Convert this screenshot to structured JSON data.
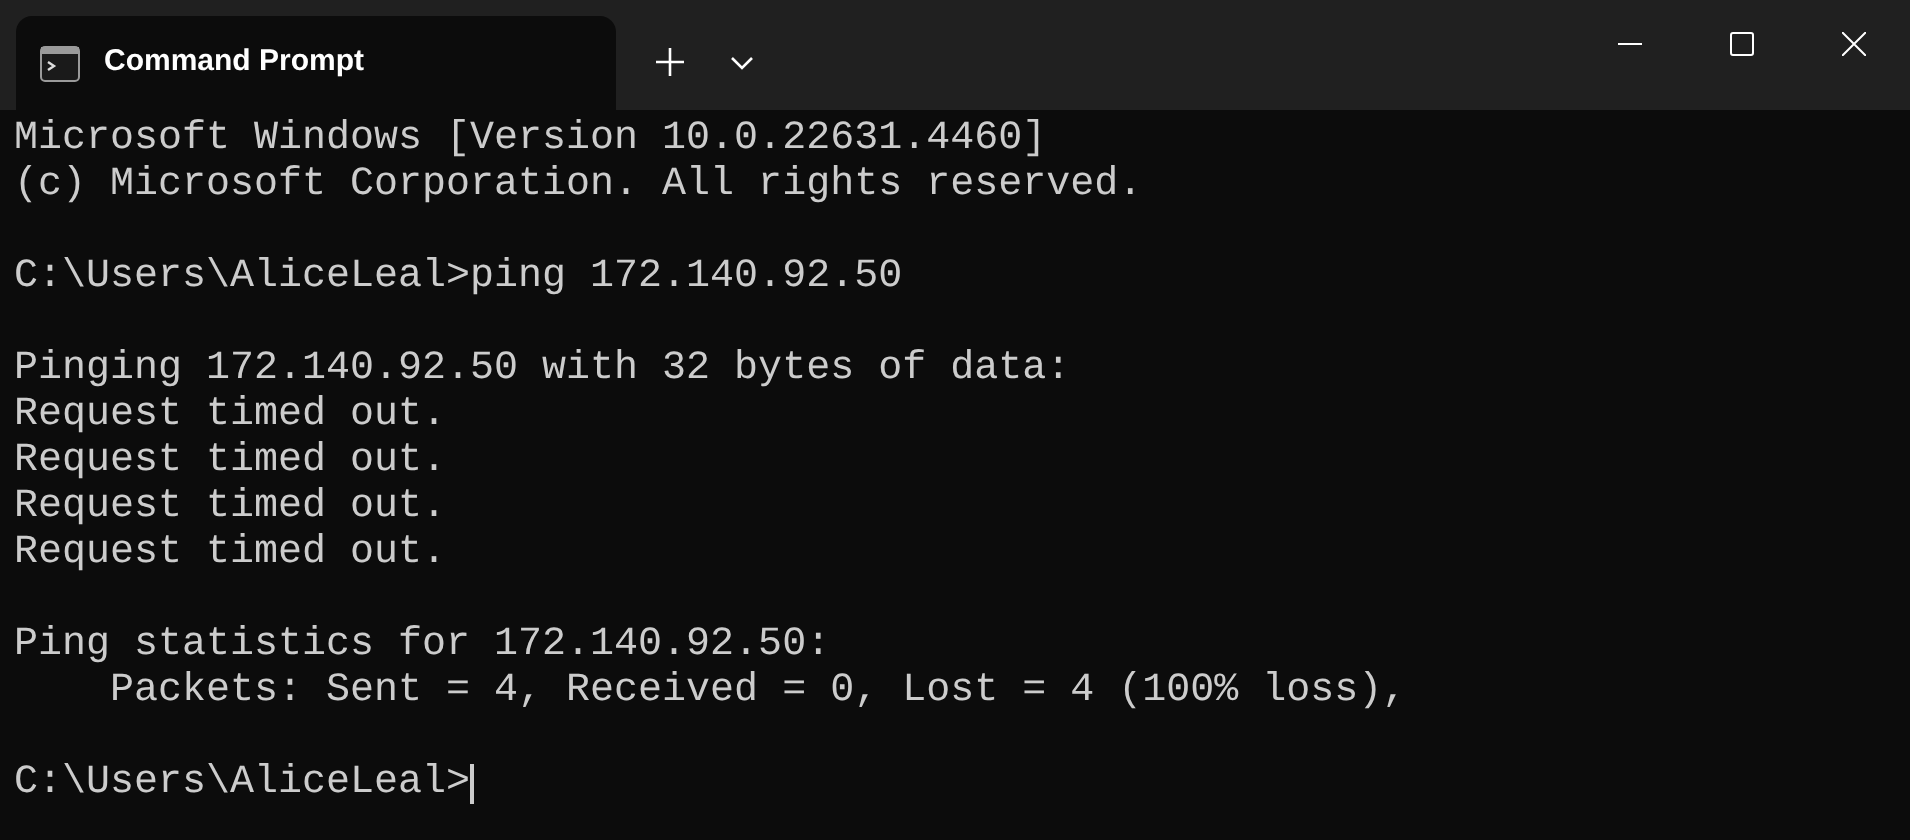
{
  "tabs": [
    {
      "title": "Command Prompt",
      "selected": true
    }
  ],
  "terminal": {
    "blocks": [
      [
        "Microsoft Windows [Version 10.0.22631.4460]",
        "(c) Microsoft Corporation. All rights reserved."
      ],
      [
        "C:\\Users\\AliceLeal>ping 172.140.92.50"
      ],
      [
        "Pinging 172.140.92.50 with 32 bytes of data:",
        "Request timed out.",
        "Request timed out.",
        "Request timed out.",
        "Request timed out."
      ],
      [
        "Ping statistics for 172.140.92.50:",
        "    Packets: Sent = 4, Received = 0, Lost = 4 (100% loss),"
      ],
      [
        "C:\\Users\\AliceLeal>"
      ]
    ],
    "cursor": true
  }
}
